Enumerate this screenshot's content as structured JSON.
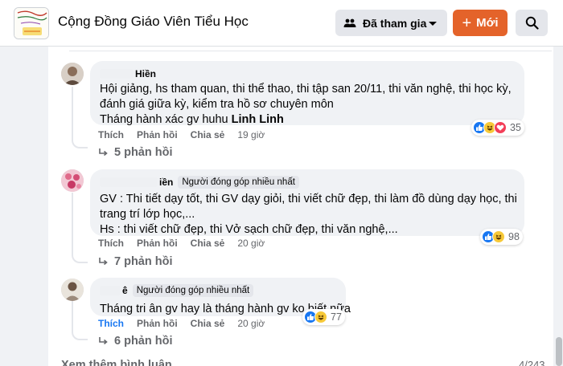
{
  "header": {
    "group_name": "Cộng Đồng Giáo Viên Tiểu Học",
    "joined_label": "Đã tham gia",
    "new_label": "Mới",
    "accent_color": "#e4632a"
  },
  "comments": [
    {
      "author_visible": "Hiền",
      "badge": "",
      "lines": [
        "Hội giảng, hs tham quan, thi thể thao, thi tập san 20/11, thi văn nghệ, thi học kỳ,",
        "đánh giá giữa kỳ, kiểm tra hồ sơ chuyên môn"
      ],
      "last_line_text": "Tháng hành xác gv huhu ",
      "mention": "Linh Linh",
      "actions": {
        "like": "Thích",
        "reply": "Phản hồi",
        "share": "Chia sẻ",
        "time": "19 giờ"
      },
      "reaction_count": "35",
      "reaction_icons": [
        "like-reaction-icon",
        "haha-reaction-icon",
        "love-reaction-icon"
      ],
      "replies": "5 phản hồi"
    },
    {
      "author_visible": "iền",
      "badge": "Người đóng góp nhiều nhất",
      "lines": [
        "GV : Thi tiết dạy tốt, thi GV dạy giỏi, thi viết chữ đẹp, thi làm đồ dùng dạy học, thi",
        "trang trí lớp học,...",
        "Hs : thi viết chữ đẹp, thi Vở sạch chữ đẹp, thi văn nghệ,..."
      ],
      "actions": {
        "like": "Thích",
        "reply": "Phản hồi",
        "share": "Chia sẻ",
        "time": "20 giờ"
      },
      "reaction_count": "98",
      "reaction_icons": [
        "like-reaction-icon",
        "haha-reaction-icon"
      ],
      "replies": "7 phản hồi"
    },
    {
      "author_visible": "ê",
      "badge": "Người đóng góp nhiều nhất",
      "lines": [
        "Tháng tri ân gv hay là tháng hành gv ko biết nữa"
      ],
      "actions": {
        "like": "Thích",
        "reply": "Phản hồi",
        "share": "Chia sẻ",
        "time": "20 giờ"
      },
      "reaction_count": "77",
      "reaction_icons": [
        "like-reaction-icon",
        "haha-reaction-icon"
      ],
      "replies": "6 phản hồi"
    }
  ],
  "footer": {
    "view_more": "Xem thêm bình luận",
    "pager": "4/243"
  }
}
